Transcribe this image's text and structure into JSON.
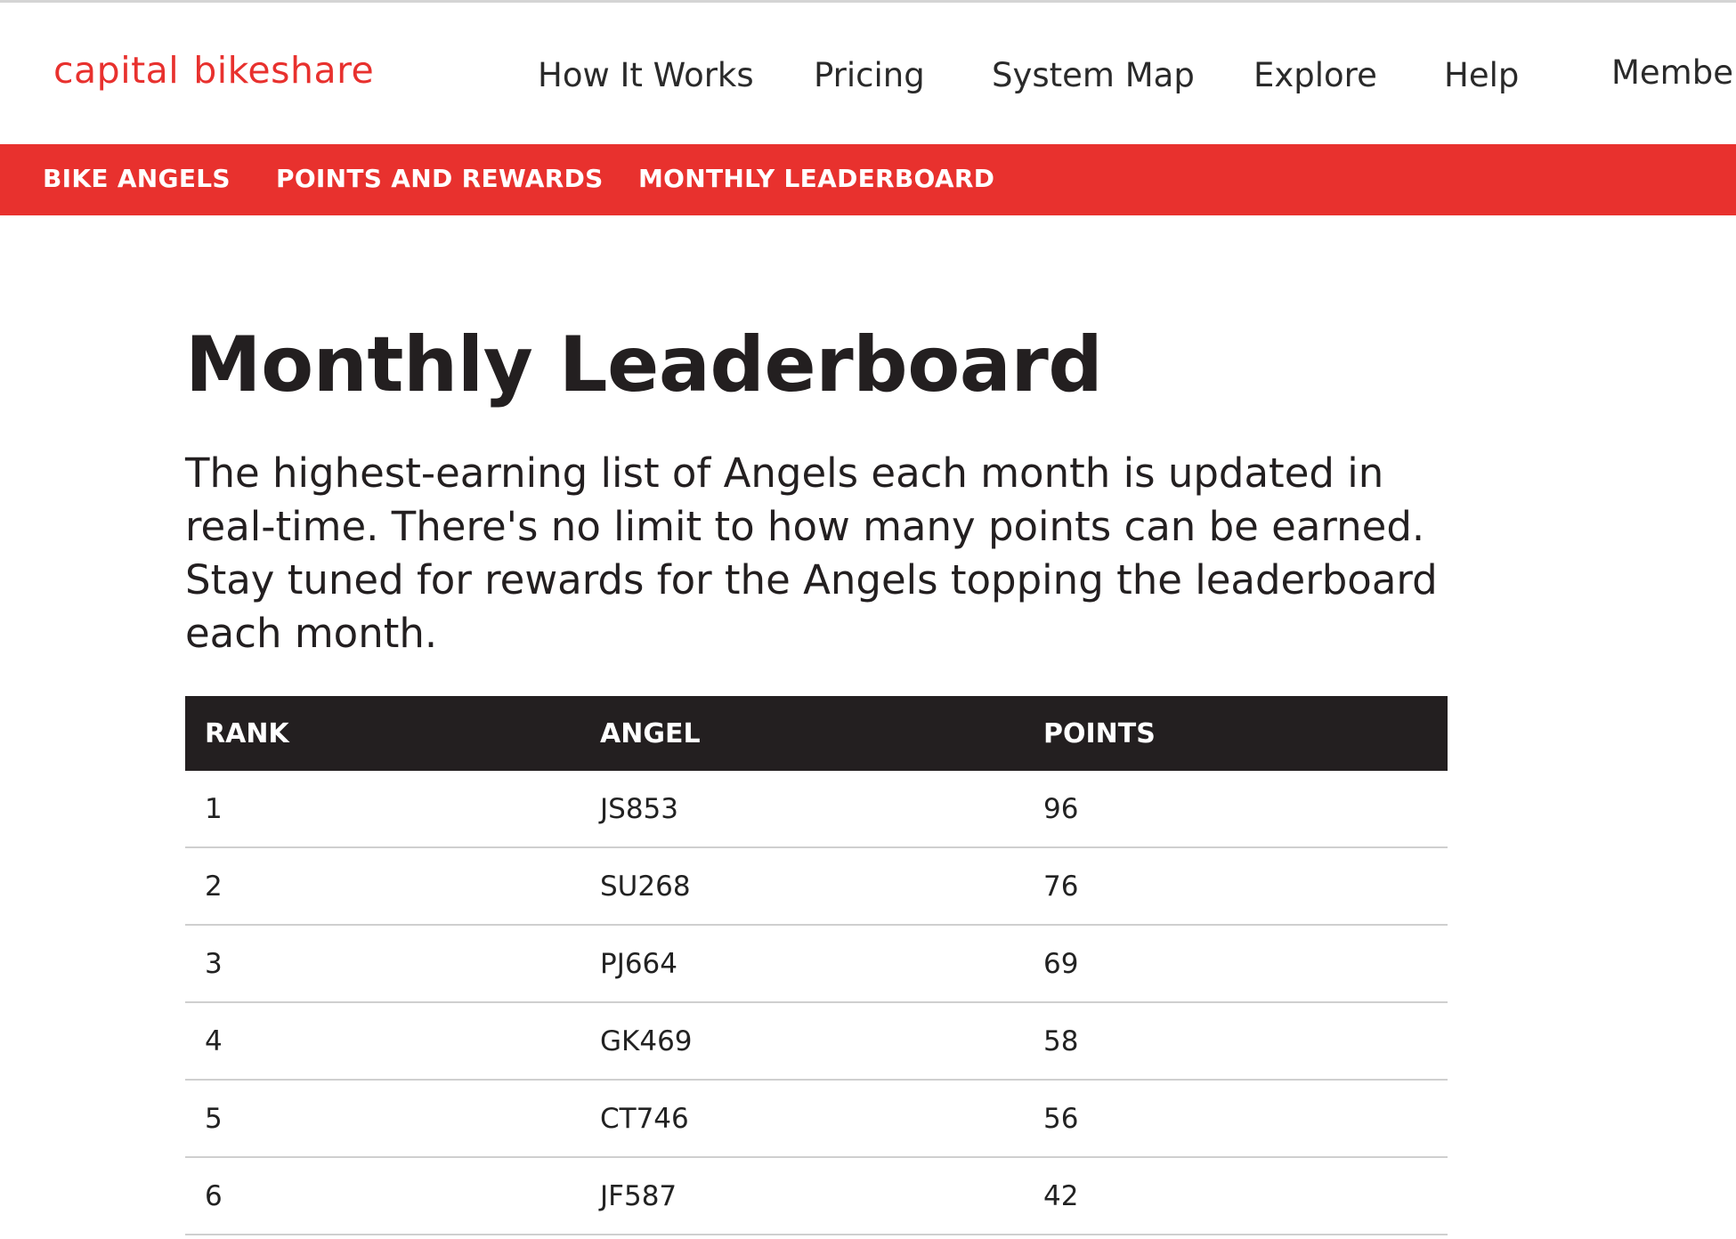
{
  "header": {
    "logo_text_1": "capital",
    "logo_text_2": "bikeshare",
    "brand_color": "#e8312e",
    "nav": [
      {
        "label": "How It Works"
      },
      {
        "label": "Pricing"
      },
      {
        "label": "System Map"
      },
      {
        "label": "Explore"
      },
      {
        "label": "Help"
      },
      {
        "label": "Member"
      }
    ]
  },
  "subnav": {
    "items": [
      {
        "label": "BIKE ANGELS"
      },
      {
        "label": "POINTS AND REWARDS"
      },
      {
        "label": "MONTHLY LEADERBOARD"
      }
    ]
  },
  "main": {
    "title": "Monthly Leaderboard",
    "intro": "The highest-earning list of Angels each month is updated in real-time. There's no limit to how many points can be earned. Stay tuned for rewards for the Angels topping the leaderboard each month.",
    "table": {
      "columns": [
        "RANK",
        "ANGEL",
        "POINTS"
      ],
      "rows": [
        {
          "rank": "1",
          "angel": "JS853",
          "points": "96"
        },
        {
          "rank": "2",
          "angel": "SU268",
          "points": "76"
        },
        {
          "rank": "3",
          "angel": "PJ664",
          "points": "69"
        },
        {
          "rank": "4",
          "angel": "GK469",
          "points": "58"
        },
        {
          "rank": "5",
          "angel": "CT746",
          "points": "56"
        },
        {
          "rank": "6",
          "angel": "JF587",
          "points": "42"
        }
      ]
    }
  }
}
